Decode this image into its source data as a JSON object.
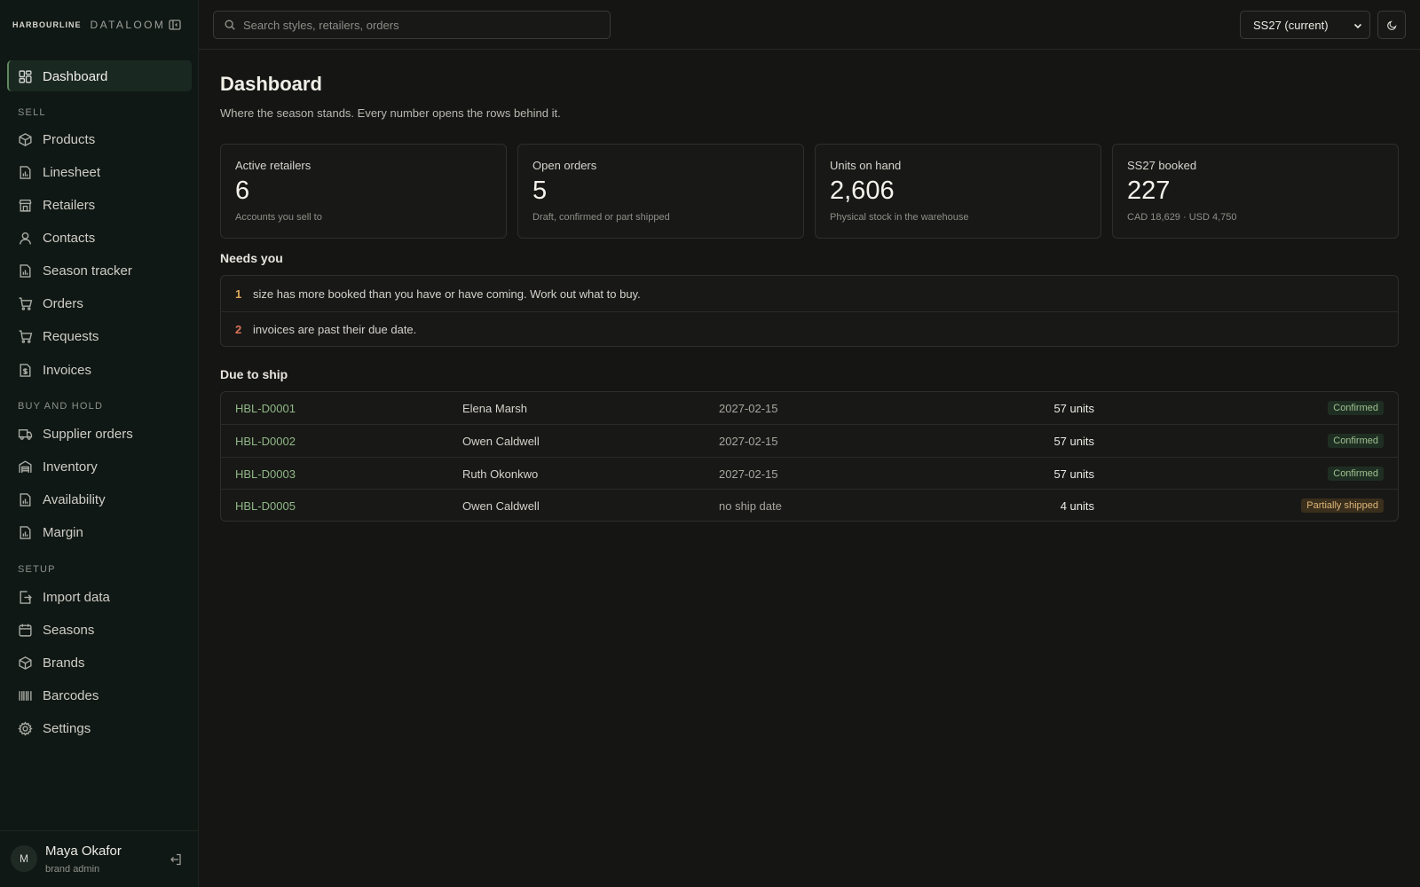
{
  "app": {
    "brand_mark": "HARBOURLINE",
    "brand_name": "DATALOOM"
  },
  "sidebar": {
    "items": [
      {
        "label": "Dashboard",
        "icon": "dashboard-icon",
        "active": true
      },
      {
        "label": "Products",
        "icon": "box-icon"
      },
      {
        "label": "Linesheet",
        "icon": "chart-file-icon"
      },
      {
        "label": "Retailers",
        "icon": "store-icon"
      },
      {
        "label": "Contacts",
        "icon": "user-icon"
      },
      {
        "label": "Season tracker",
        "icon": "chart-file-icon"
      },
      {
        "label": "Orders",
        "icon": "cart-icon"
      },
      {
        "label": "Requests",
        "icon": "cart-icon"
      },
      {
        "label": "Invoices",
        "icon": "invoice-icon"
      },
      {
        "label": "Supplier orders",
        "icon": "truck-icon"
      },
      {
        "label": "Inventory",
        "icon": "warehouse-icon"
      },
      {
        "label": "Availability",
        "icon": "chart-file-icon"
      },
      {
        "label": "Margin",
        "icon": "chart-file-icon"
      },
      {
        "label": "Import data",
        "icon": "import-icon"
      },
      {
        "label": "Seasons",
        "icon": "calendar-icon"
      },
      {
        "label": "Brands",
        "icon": "box-icon"
      },
      {
        "label": "Barcodes",
        "icon": "barcode-icon"
      },
      {
        "label": "Settings",
        "icon": "gear-icon"
      }
    ],
    "sections": {
      "sell": "SELL",
      "buy_and_hold": "BUY AND HOLD",
      "setup": "SETUP"
    },
    "user": {
      "initial": "M",
      "name": "Maya Okafor",
      "role": "brand admin"
    }
  },
  "topbar": {
    "search_placeholder": "Search styles, retailers, orders",
    "season": "SS27 (current)"
  },
  "main": {
    "title": "Dashboard",
    "subtitle": "Where the season stands. Every number opens the rows behind it.",
    "cards": [
      {
        "label": "Active retailers",
        "value": "6",
        "note": "Accounts you sell to"
      },
      {
        "label": "Open orders",
        "value": "5",
        "note": "Draft, confirmed or part shipped"
      },
      {
        "label": "Units on hand",
        "value": "2,606",
        "note": "Physical stock in the warehouse"
      },
      {
        "label": "SS27 booked",
        "value": "227",
        "note": "CAD 18,629 · USD 4,750"
      }
    ],
    "needs_title": "Needs you",
    "needs": [
      {
        "count": "1",
        "text": "size has more booked than you have or have coming. Work out what to buy.",
        "color": "#d9a55a"
      },
      {
        "count": "2",
        "text": "invoices are past their due date.",
        "color": "#d9735a"
      }
    ],
    "ship_title": "Due to ship",
    "ship_rows": [
      {
        "order": "HBL-D0001",
        "retailer": "Elena Marsh",
        "date": "2027-02-15",
        "units": "57 units",
        "status": "Confirmed"
      },
      {
        "order": "HBL-D0002",
        "retailer": "Owen Caldwell",
        "date": "2027-02-15",
        "units": "57 units",
        "status": "Confirmed"
      },
      {
        "order": "HBL-D0003",
        "retailer": "Ruth Okonkwo",
        "date": "2027-02-15",
        "units": "57 units",
        "status": "Confirmed"
      },
      {
        "order": "HBL-D0005",
        "retailer": "Owen Caldwell",
        "date": "no ship date",
        "units": "4 units",
        "status": "Partially shipped"
      }
    ]
  }
}
